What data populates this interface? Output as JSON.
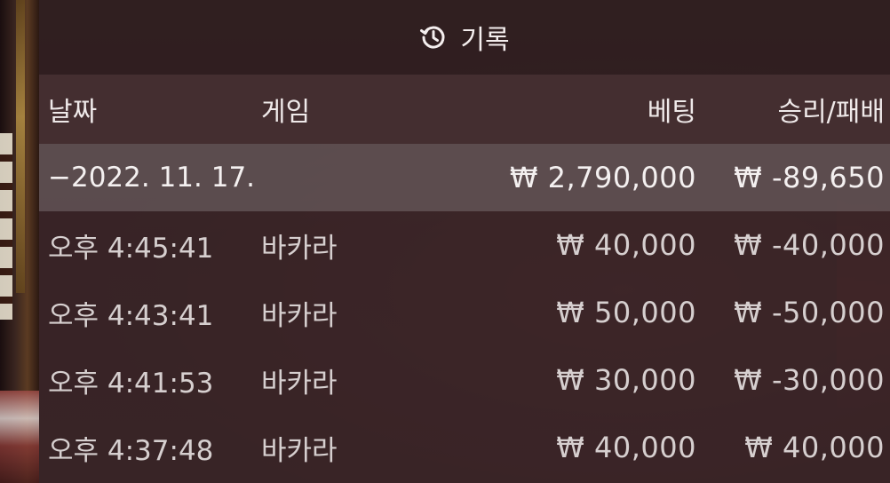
{
  "header": {
    "icon": "history-icon",
    "title": "기록"
  },
  "columns": {
    "date": "날짜",
    "game": "게임",
    "bet": "베팅",
    "winloss": "승리/패배"
  },
  "summary": {
    "date": "−2022. 11. 17.",
    "game": "",
    "bet": "₩ 2,790,000",
    "winloss": "₩ -89,650"
  },
  "rows": [
    {
      "time": "오후 4:45:41",
      "game": "바카라",
      "bet": "₩ 40,000",
      "winloss": "₩ -40,000"
    },
    {
      "time": "오후 4:43:41",
      "game": "바카라",
      "bet": "₩ 50,000",
      "winloss": "₩ -50,000"
    },
    {
      "time": "오후 4:41:53",
      "game": "바카라",
      "bet": "₩ 30,000",
      "winloss": "₩ -30,000"
    },
    {
      "time": "오후 4:37:48",
      "game": "바카라",
      "bet": "₩ 40,000",
      "winloss": "₩ 40,000"
    }
  ]
}
